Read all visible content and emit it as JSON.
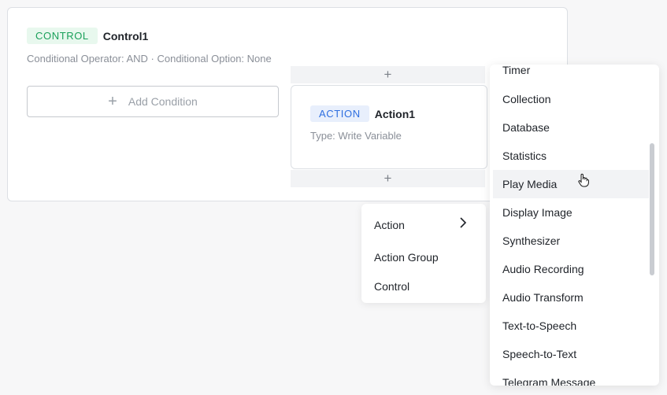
{
  "control": {
    "tag": "CONTROL",
    "name": "Control1",
    "subtitle": "Conditional Operator: AND · Conditional Option: None",
    "add_condition_label": "Add Condition"
  },
  "action": {
    "tag": "ACTION",
    "name": "Action1",
    "subtitle": "Type: Write Variable"
  },
  "insert_plus": "+",
  "menu": {
    "items": [
      "Action",
      "Action Group",
      "Control"
    ]
  },
  "submenu": {
    "items": [
      "Timer",
      "Collection",
      "Database",
      "Statistics",
      "Play Media",
      "Display Image",
      "Synthesizer",
      "Audio Recording",
      "Audio Transform",
      "Text-to-Speech",
      "Speech-to-Text",
      "Telegram Message"
    ],
    "hovered": "Play Media"
  }
}
